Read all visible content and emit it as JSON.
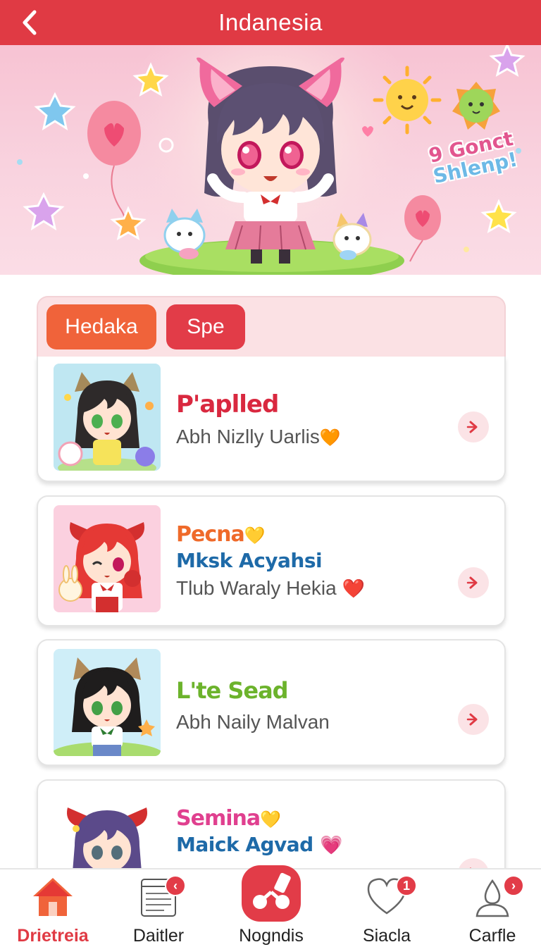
{
  "header": {
    "title": "Indanesia"
  },
  "banner": {
    "text_line1": "9 Gonct",
    "text_line2": "Shlenp!"
  },
  "tabs": [
    {
      "label": "Hedaka"
    },
    {
      "label": "Spe"
    }
  ],
  "cards": [
    {
      "name": "P'aplled",
      "name_color": "#d9283f",
      "subtitle": "Abh Nizlly Uarlis",
      "subtitle_emoji": "🧡"
    },
    {
      "name": "Pecna",
      "name_emoji": "💛",
      "name_color": "#ef6a2a",
      "subtitle2": "Mksk Acyahsi",
      "subtitle": "Tlub Waraly Hekia",
      "subtitle_emoji": "❤️"
    },
    {
      "name": "L'te Sead",
      "name_color": "#6cb32c",
      "subtitle": "Abh Naily Malvan"
    },
    {
      "name": "Semina",
      "name_emoji": "💛",
      "name_color": "#e0408f",
      "subtitle2": "Maick Agvad",
      "subtitle2_emoji": "💗"
    }
  ],
  "bottom_nav": [
    {
      "label": "Drietreia",
      "icon": "home-icon",
      "active": true
    },
    {
      "label": "Daitler",
      "icon": "document-icon",
      "badge": "‹"
    },
    {
      "label": "Nogndis",
      "icon": "game-icon"
    },
    {
      "label": "Siacla",
      "icon": "heart-icon",
      "badge": "1"
    },
    {
      "label": "Carfle",
      "icon": "profile-icon",
      "badge": "›"
    }
  ],
  "colors": {
    "primary": "#e03a44",
    "tab_orange": "#f0633a",
    "banner_pink": "#f7c3d3"
  }
}
